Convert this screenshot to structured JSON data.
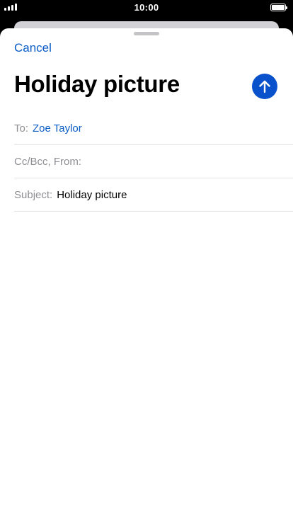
{
  "status_bar": {
    "time": "10:00"
  },
  "compose": {
    "cancel_label": "Cancel",
    "title": "Holiday picture",
    "send_icon": "arrow-up-icon",
    "to_label": "To:",
    "to_recipient": "Zoe Taylor",
    "cc_label": "Cc/Bcc, From:",
    "subject_label": "Subject:",
    "subject_value": "Holiday picture"
  },
  "colors": {
    "accent": "#0a5cc7",
    "send_button": "#0a52cc",
    "label_gray": "#8e8e93"
  }
}
